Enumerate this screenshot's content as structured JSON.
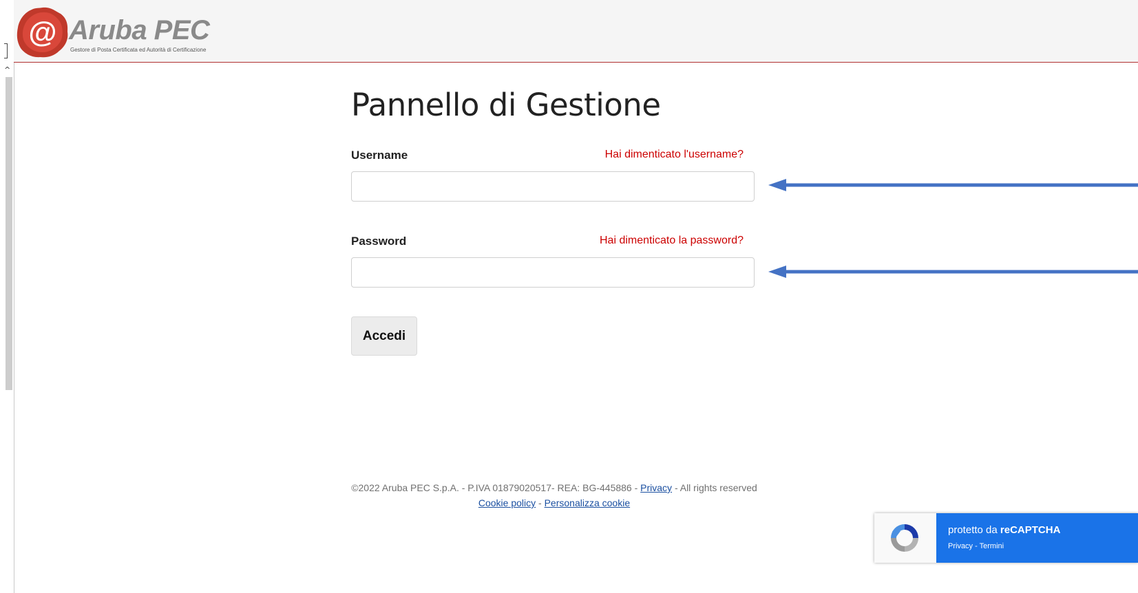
{
  "header": {
    "brand_name": "Aruba PEC",
    "brand_tagline": "Gestore di Posta Certificata ed Autorità di Certificazione"
  },
  "login": {
    "title": "Pannello di Gestione",
    "username_label": "Username",
    "username_forgot_link": "Hai dimenticato l'username?",
    "username_value": "",
    "password_label": "Password",
    "password_forgot_link": "Hai dimenticato la password?",
    "password_value": "",
    "submit_label": "Accedi"
  },
  "footer": {
    "copyright": "©2022 Aruba PEC S.p.A. - P.IVA 01879020517- REA: BG-445886 -",
    "privacy_link": "Privacy",
    "rights": "- All rights reserved",
    "cookie_policy_link": "Cookie policy",
    "separator": "-",
    "customize_cookie_link": "Personalizza cookie"
  },
  "recaptcha": {
    "protected_by": "protetto da",
    "brand": "reCAPTCHA",
    "privacy_link": "Privacy",
    "separator": "-",
    "terms_link": "Termini"
  },
  "colors": {
    "link_red": "#cc0000",
    "header_border": "#b03030",
    "annotation_arrow": "#4472c4",
    "recaptcha_blue": "#1a73e8"
  }
}
